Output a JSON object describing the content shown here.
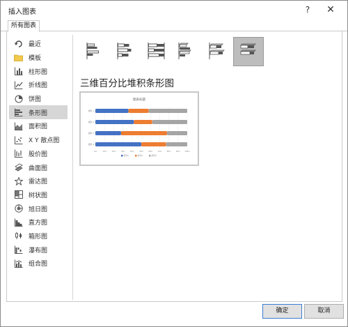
{
  "dialog": {
    "title": "插入图表",
    "help_label": "?",
    "close_label": "✕"
  },
  "tabs": [
    {
      "label": "所有图表"
    }
  ],
  "sidebar": {
    "items": [
      {
        "label": "最近",
        "icon": "recent-icon"
      },
      {
        "label": "模板",
        "icon": "folder-icon"
      },
      {
        "label": "柱形图",
        "icon": "column-chart-icon"
      },
      {
        "label": "折线图",
        "icon": "line-chart-icon"
      },
      {
        "label": "饼图",
        "icon": "pie-chart-icon"
      },
      {
        "label": "条形图",
        "icon": "bar-chart-icon",
        "selected": true
      },
      {
        "label": "面积图",
        "icon": "area-chart-icon"
      },
      {
        "label": "X Y 散点图",
        "icon": "scatter-chart-icon"
      },
      {
        "label": "股价图",
        "icon": "stock-chart-icon"
      },
      {
        "label": "曲面图",
        "icon": "surface-chart-icon"
      },
      {
        "label": "雷达图",
        "icon": "radar-chart-icon"
      },
      {
        "label": "树状图",
        "icon": "treemap-chart-icon"
      },
      {
        "label": "旭日图",
        "icon": "sunburst-chart-icon"
      },
      {
        "label": "直方图",
        "icon": "histogram-chart-icon"
      },
      {
        "label": "箱形图",
        "icon": "boxplot-chart-icon"
      },
      {
        "label": "瀑布图",
        "icon": "waterfall-chart-icon"
      },
      {
        "label": "组合图",
        "icon": "combo-chart-icon"
      }
    ]
  },
  "subtypes": [
    {
      "icon": "clustered-bar-icon"
    },
    {
      "icon": "stacked-bar-icon"
    },
    {
      "icon": "percent-stacked-bar-icon"
    },
    {
      "icon": "3d-clustered-bar-icon"
    },
    {
      "icon": "3d-stacked-bar-icon"
    },
    {
      "icon": "3d-percent-stacked-bar-icon",
      "selected": true
    }
  ],
  "selected_chart_title": "三维百分比堆积条形图",
  "preview": {
    "chart_data": {
      "type": "bar",
      "title": "图表标题",
      "categories": [
        "类别 1",
        "类别 2",
        "类别 3",
        "类别 4"
      ],
      "series": [
        {
          "name": "系列1",
          "color": "#4472c4",
          "values": [
            36,
            42,
            28,
            50
          ]
        },
        {
          "name": "系列2",
          "color": "#ed7d31",
          "values": [
            22,
            20,
            50,
            27
          ]
        },
        {
          "name": "系列3",
          "color": "#a5a5a5",
          "values": [
            42,
            38,
            22,
            23
          ]
        }
      ],
      "x_ticks": [
        "0%",
        "10%",
        "20%",
        "30%",
        "40%",
        "50%",
        "60%",
        "70%",
        "80%",
        "90%",
        "100%"
      ],
      "stacked": "percent",
      "legend": "bottom"
    }
  },
  "buttons": {
    "ok": "确定",
    "cancel": "取消"
  },
  "colors": {
    "selection": "#d6d6d6",
    "ok_border": "#3a7bd5"
  }
}
